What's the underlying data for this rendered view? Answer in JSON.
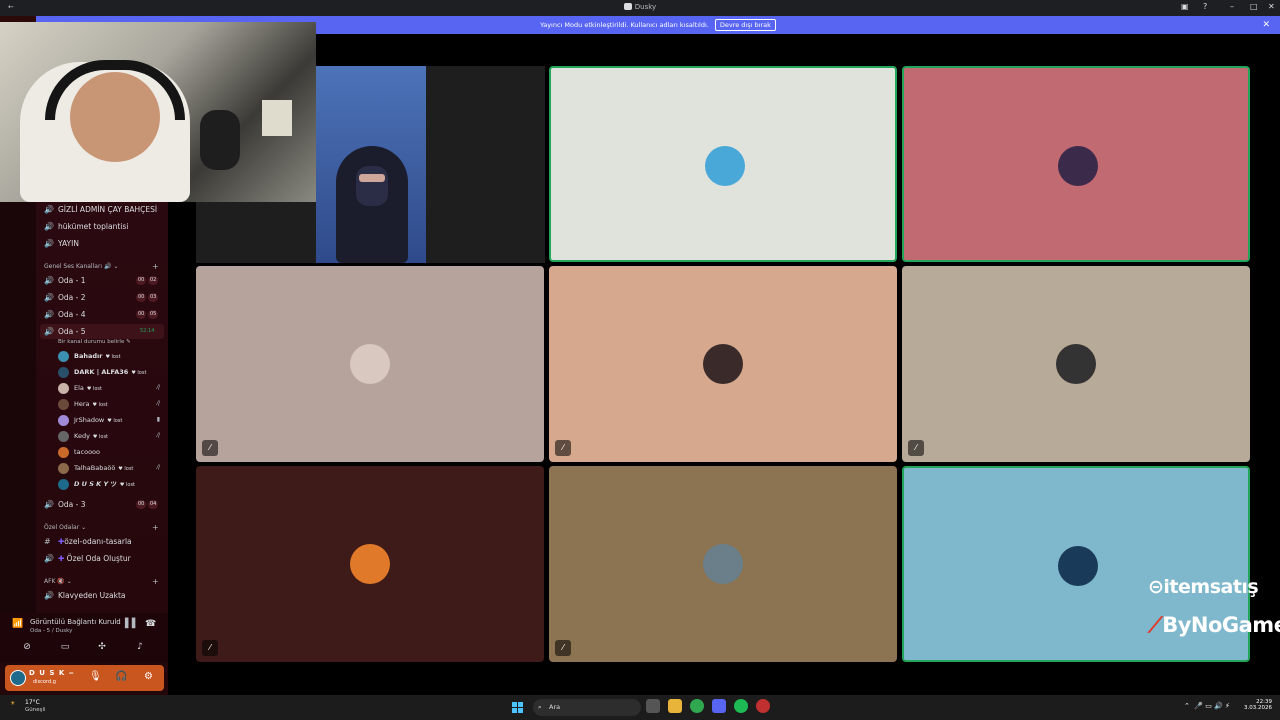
{
  "window": {
    "title": "Dusky",
    "back": "←",
    "controls": [
      "▣",
      "?",
      "–",
      "□",
      "✕"
    ]
  },
  "banner": {
    "message": "Yayıncı Modu etkinleştirildi. Kullanıcı adları kısaltıldı.",
    "action": "Devre dışı bırak",
    "close": "✕"
  },
  "sidebar": {
    "channels_top": [
      {
        "name": "GİZLİ ADMİN ÇAY BAHÇESİ"
      },
      {
        "name": "hükümet toplantisi"
      },
      {
        "name": "YAYIN"
      }
    ],
    "category_general": "Genel Ses Kanalları",
    "voice_channels": [
      {
        "name": "Oda - 1",
        "b1": "00",
        "b2": "02"
      },
      {
        "name": "Oda - 2",
        "b1": "00",
        "b2": "03"
      },
      {
        "name": "Oda - 4",
        "b1": "00",
        "b2": "05"
      },
      {
        "name": "Oda - 5",
        "time": "52:14",
        "status": "Bir kanal durumu belirle"
      }
    ],
    "members": [
      {
        "name": "Bahadır",
        "tag": "lost",
        "color": "#3b8fb0"
      },
      {
        "name": "DARK | ALFA36",
        "tag": "lost",
        "color": "#2a4f6a"
      },
      {
        "name": "Ela",
        "tag": "lost",
        "color": "#c9b2a8",
        "icon": "muted"
      },
      {
        "name": "Hera",
        "tag": "lost",
        "color": "#6a4a3a",
        "icon": "muted"
      },
      {
        "name": "JrShadow",
        "tag": "lost",
        "color": "#a08ad8",
        "icon": "video"
      },
      {
        "name": "Kedy",
        "tag": "lost",
        "color": "#666",
        "icon": "muted"
      },
      {
        "name": "tacoooo",
        "tag": "",
        "color": "#c96a2a"
      },
      {
        "name": "TalhaBabaöö",
        "tag": "lost",
        "color": "#8a6a4a",
        "icon": "muted"
      },
      {
        "name": "𝘿 𝙐 𝙎 𝙆 𝙔 ツ",
        "tag": "lost",
        "color": "#1d6a8a"
      }
    ],
    "oda3": {
      "name": "Oda - 3",
      "b1": "00",
      "b2": "04"
    },
    "category_private": "Özel Odalar",
    "private": [
      {
        "name": "özel-odanı-tasarla"
      },
      {
        "name": "Özel Oda Oluştur"
      }
    ],
    "category_afk": "AFK",
    "afk": [
      {
        "name": "Klavyeden Uzakta"
      }
    ]
  },
  "voice_panel": {
    "title": "Görüntülü Bağlantı Kuruld",
    "sub": "Oda - 5 / Dusky"
  },
  "user_panel": {
    "name": "D U S K ‒",
    "sub": "discord.g"
  },
  "grid_tiles": [
    {
      "color": "#e0e3dc",
      "avatar": "#4aa8d8",
      "selected": true
    },
    {
      "color": "#c26a72",
      "avatar": "#3b2a4a",
      "selected": true
    },
    {
      "color": "#b6a39c",
      "avatar": "#d8c8c0",
      "muted": true
    },
    {
      "color": "#d6a88e",
      "avatar": "#3a2a2a",
      "muted": true
    },
    {
      "color": "#b7aa98",
      "avatar": "#333333",
      "muted": true
    },
    {
      "color": "#3e1b18",
      "avatar": "#e07a2a",
      "muted": true
    },
    {
      "color": "#8c7352",
      "avatar": "#6a7f8a",
      "muted": true
    },
    {
      "color": "#7fb8cc",
      "avatar": "#1a3a5a",
      "selected": true
    }
  ],
  "watermarks": {
    "a": "itemsatış",
    "b": "ByNoGame"
  },
  "taskbar": {
    "temp": "17°C",
    "weather": "Güneşli",
    "search": "Ara",
    "time": "22:39",
    "date": "3.03.2026"
  }
}
